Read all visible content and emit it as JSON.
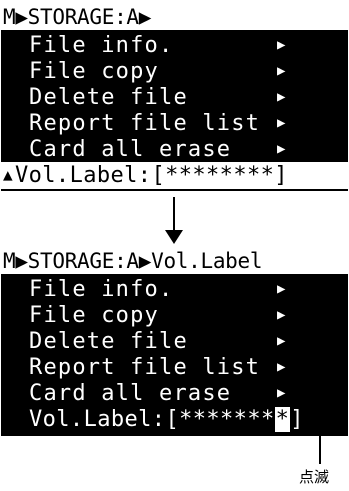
{
  "screen1": {
    "title": "M▶STORAGE:A▶",
    "items": [
      {
        "label": "File info.",
        "arrow": "▶"
      },
      {
        "label": "File copy",
        "arrow": "▶"
      },
      {
        "label": "Delete file",
        "arrow": "▶"
      },
      {
        "label": "Report file list",
        "arrow": "▶"
      },
      {
        "label": "Card all erase",
        "arrow": "▶"
      }
    ],
    "vol_label_row": {
      "marker": "▲",
      "text": "Vol.Label:[********]"
    }
  },
  "screen2": {
    "title": "M▶STORAGE:A▶Vol.Label",
    "items": [
      {
        "label": "File info.",
        "arrow": "▶"
      },
      {
        "label": "File copy",
        "arrow": "▶"
      },
      {
        "label": "Delete file",
        "arrow": "▶"
      },
      {
        "label": "Report file list",
        "arrow": "▶"
      },
      {
        "label": "Card all erase",
        "arrow": "▶"
      }
    ],
    "vol_label_row": {
      "prefix": "Vol.Label:[*******",
      "blinking_char": "*",
      "suffix": "]"
    }
  },
  "annotation": {
    "blink_label": "点滅"
  }
}
